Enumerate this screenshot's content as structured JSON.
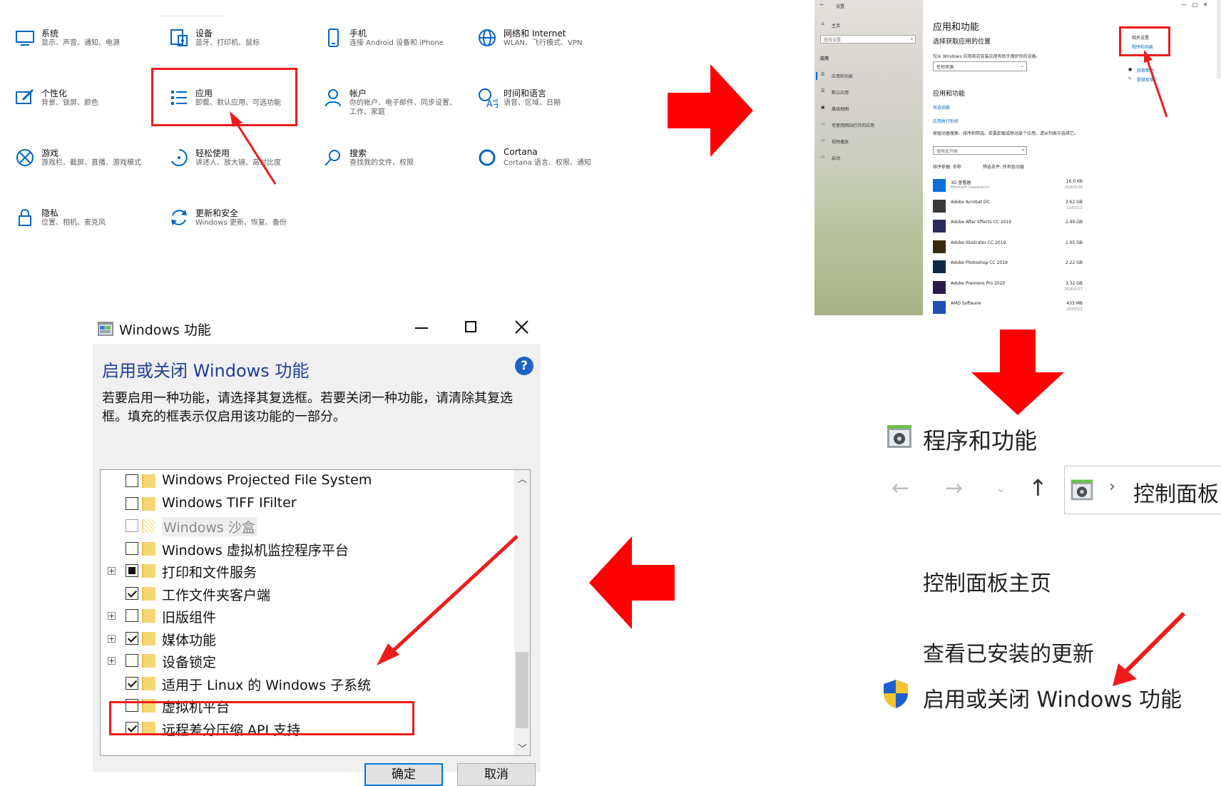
{
  "settings": {
    "tiles": [
      {
        "title": "系统",
        "desc": "显示、声音、通知、电源",
        "icon": "monitor-icon"
      },
      {
        "title": "设备",
        "desc": "蓝牙、打印机、鼠标",
        "icon": "keyboard-device-icon"
      },
      {
        "title": "手机",
        "desc": "连接 Android 设备和 iPhone",
        "icon": "phone-icon"
      },
      {
        "title": "网络和 Internet",
        "desc": "WLAN、飞行模式、VPN",
        "icon": "globe-icon"
      },
      {
        "title": "个性化",
        "desc": "背景、锁屏、颜色",
        "icon": "paint-icon"
      },
      {
        "title": "应用",
        "desc": "卸载、默认应用、可选功能",
        "icon": "apps-list-icon"
      },
      {
        "title": "帐户",
        "desc": "你的帐户、电子邮件、同步设置、工作、家庭",
        "icon": "person-icon"
      },
      {
        "title": "时间和语言",
        "desc": "语音、区域、日期",
        "icon": "time-language-icon"
      },
      {
        "title": "游戏",
        "desc": "游戏栏、截屏、直播、游戏模式",
        "icon": "xbox-icon"
      },
      {
        "title": "轻松使用",
        "desc": "讲述人、放大镜、高对比度",
        "icon": "ease-of-access-icon"
      },
      {
        "title": "搜索",
        "desc": "查找我的文件、权限",
        "icon": "search-icon"
      },
      {
        "title": "Cortana",
        "desc": "Cortana 语言、权限、通知",
        "icon": "cortana-icon"
      },
      {
        "title": "隐私",
        "desc": "位置、相机、麦克风",
        "icon": "lock-icon"
      },
      {
        "title": "更新和安全",
        "desc": "Windows 更新、恢复、备份",
        "icon": "update-icon"
      }
    ]
  },
  "apps_panel": {
    "window_title": "设置",
    "window_controls": [
      "—",
      "□",
      "✕"
    ],
    "nav_home": "主页",
    "search_placeholder": "查找设置",
    "section": "应用",
    "nav_items": [
      "应用和功能",
      "默认应用",
      "离线地图",
      "可使用网站打开的应用",
      "视频播放",
      "启动"
    ],
    "page_title": "应用和功能",
    "choose_source": "选择获取应用的位置",
    "source_hint": "仅从 Windows 应用商店安装应用有助于保护你的设备。",
    "source_value": "任何来源",
    "apps_heading": "应用和功能",
    "link_optional": "可选功能",
    "link_aliases": "应用执行别名",
    "search_hint": "按驱动器搜索、排序和筛选。若要卸载或移动某个应用，请从列表中选择它。",
    "search_list_placeholder": "搜索此列表",
    "sort_label": "排序依据: 名称",
    "filter_label": "筛选条件: 所有驱动器",
    "related_title": "相关设置",
    "related_link": "程序和功能",
    "help_link": "获取帮助",
    "feedback_link": "提供反馈",
    "apps": [
      {
        "name": "3D 查看器",
        "publisher": "Microsoft Corporation",
        "size": "16.0 KB",
        "date": "2020/5/16",
        "color": "#0a6fd6"
      },
      {
        "name": "Adobe Acrobat DC",
        "publisher": "",
        "size": "2.62 GB",
        "date": "2020/5/2",
        "color": "#3a3a3a"
      },
      {
        "name": "Adobe After Effects CC 2019",
        "publisher": "",
        "size": "2.99 GB",
        "date": "",
        "color": "#2b2a5a"
      },
      {
        "name": "Adobe Illustrator CC 2019",
        "publisher": "",
        "size": "1.05 GB",
        "date": "",
        "color": "#3b2a12"
      },
      {
        "name": "Adobe Photoshop CC 2019",
        "publisher": "",
        "size": "2.22 GB",
        "date": "",
        "color": "#0c2a45"
      },
      {
        "name": "Adobe Premiere Pro 2020",
        "publisher": "",
        "size": "3.32 GB",
        "date": "2020/5/27",
        "color": "#2a1a4a"
      },
      {
        "name": "AMD Software",
        "publisher": "",
        "size": "433 MB",
        "date": "2020/5/2",
        "color": "#1d4fb5"
      }
    ]
  },
  "programs_panel": {
    "title": "程序和功能",
    "breadcrumb": "控制面板",
    "home_link": "控制面板主页",
    "updates_link": "查看已安装的更新",
    "features_link": "启用或关闭 Windows 功能"
  },
  "features_dialog": {
    "window_title": "Windows 功能",
    "heading": "启用或关闭 Windows 功能",
    "description": "若要启用一种功能，请选择其复选框。若要关闭一种功能，请清除其复选框。填充的框表示仅启用该功能的一部分。",
    "items": [
      {
        "label": "Windows Projected File System",
        "state": "unchecked",
        "expandable": false,
        "disabled": false
      },
      {
        "label": "Windows TIFF IFilter",
        "state": "unchecked",
        "expandable": false,
        "disabled": false
      },
      {
        "label": "Windows 沙盒",
        "state": "unchecked",
        "expandable": false,
        "disabled": true
      },
      {
        "label": "Windows 虚拟机监控程序平台",
        "state": "unchecked",
        "expandable": false,
        "disabled": false
      },
      {
        "label": "打印和文件服务",
        "state": "partial",
        "expandable": true,
        "disabled": false
      },
      {
        "label": "工作文件夹客户端",
        "state": "checked",
        "expandable": false,
        "disabled": false
      },
      {
        "label": "旧版组件",
        "state": "unchecked",
        "expandable": true,
        "disabled": false
      },
      {
        "label": "媒体功能",
        "state": "checked",
        "expandable": true,
        "disabled": false
      },
      {
        "label": "设备锁定",
        "state": "unchecked",
        "expandable": true,
        "disabled": false
      },
      {
        "label": "适用于 Linux 的 Windows 子系统",
        "state": "checked",
        "expandable": false,
        "disabled": false
      },
      {
        "label": "虚拟机平台",
        "state": "unchecked",
        "expandable": false,
        "disabled": false
      },
      {
        "label": "远程差分压缩 API 支持",
        "state": "checked",
        "expandable": false,
        "disabled": false
      }
    ],
    "ok_label": "确定",
    "cancel_label": "取消",
    "help_glyph": "?"
  },
  "colors": {
    "accent": "#0067c0",
    "highlight_red": "#ee1c1c",
    "dialog_heading": "#1f3f94"
  }
}
